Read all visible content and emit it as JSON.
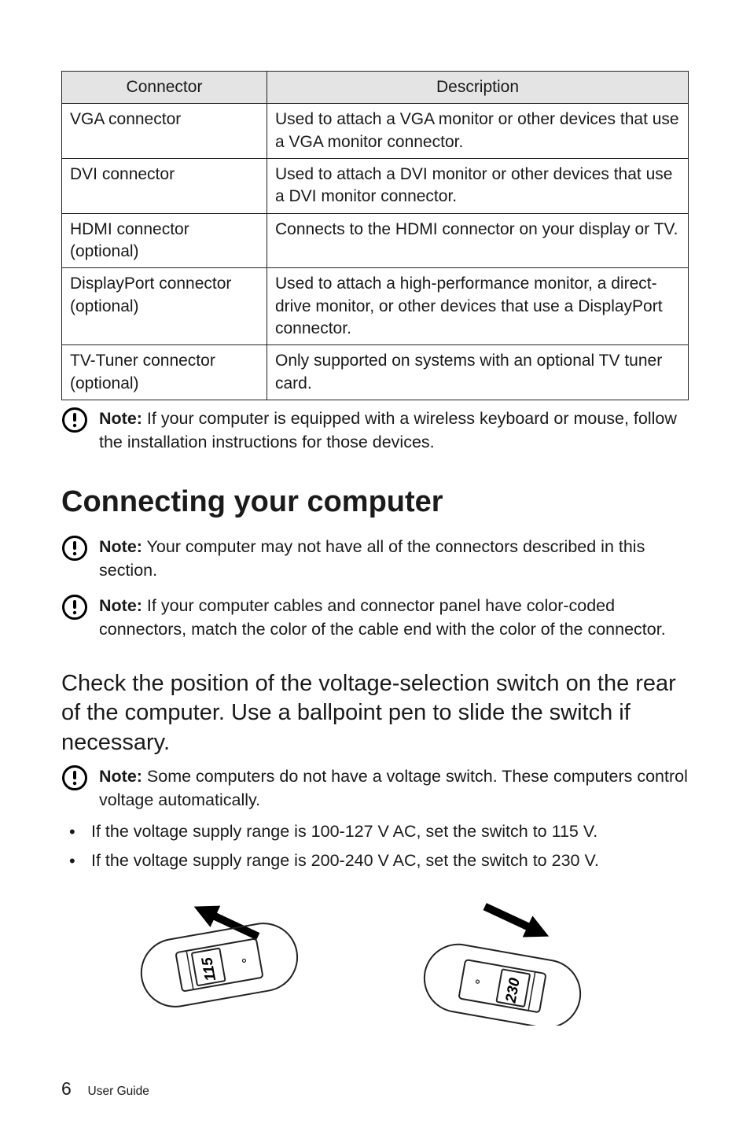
{
  "table": {
    "headers": [
      "Connector",
      "Description"
    ],
    "rows": [
      {
        "c": "VGA connector",
        "d": "Used to attach a VGA monitor or other devices that use a VGA monitor connector."
      },
      {
        "c": "DVI connector",
        "d": "Used to attach a DVI monitor or other devices that use a DVI monitor connector."
      },
      {
        "c": "HDMI connector (optional)",
        "d": "Connects to the HDMI connector on your display or TV."
      },
      {
        "c": "DisplayPort connector (optional)",
        "d": "Used to attach a high-performance monitor, a direct-drive monitor, or other devices that use a DisplayPort connector."
      },
      {
        "c": "TV-Tuner connector (optional)",
        "d": "Only supported on systems with an optional TV tuner card."
      }
    ]
  },
  "note1": {
    "label": "Note:",
    "text": " If your computer is equipped with a wireless keyboard or mouse, follow the installation instructions for those devices."
  },
  "heading": "Connecting your computer",
  "note2": {
    "label": "Note:",
    "text": " Your computer may not have all of the connectors described in this section."
  },
  "note3": {
    "label": "Note:",
    "text": " If your computer cables and connector panel have color-coded connectors, match the color of the cable end with the color of the connector."
  },
  "subheading": "Check the position of the voltage-selection switch on the rear of the computer. Use a ballpoint pen to slide the switch if necessary.",
  "note4": {
    "label": "Note:",
    "text": " Some computers do not have a voltage switch. These computers control voltage automatically."
  },
  "bullets": [
    "If the voltage supply range is 100-127 V AC, set the switch to 115 V.",
    "If the voltage supply range is 200-240 V AC, set the switch to 230 V."
  ],
  "switches": {
    "left": "115",
    "right": "230"
  },
  "footer": {
    "page": "6",
    "text": "User Guide"
  }
}
